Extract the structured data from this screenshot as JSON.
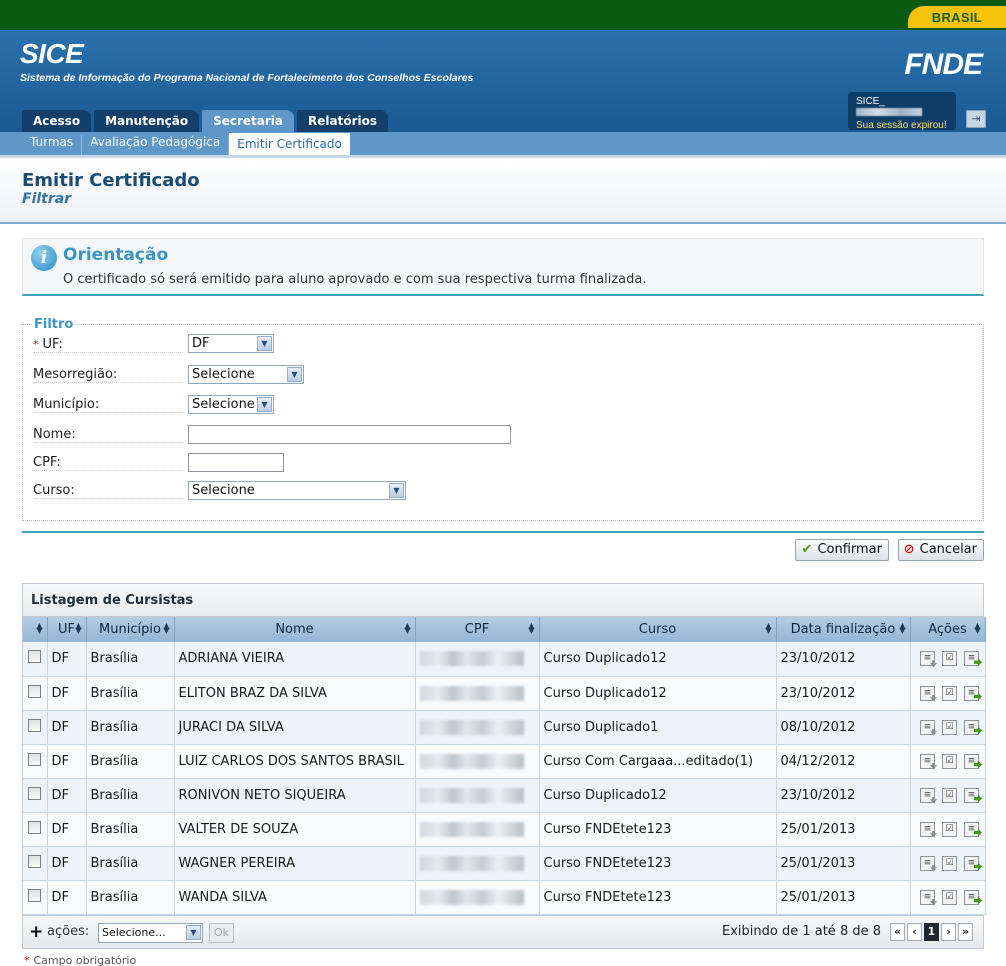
{
  "gov": {
    "brasil_label": "BRASIL"
  },
  "header": {
    "title": "SICE",
    "subtitle": "Sistema de Informação do Programa Nacional de Fortalecimento dos Conselhos Escolares",
    "org_logo": "FNDE",
    "user_prefix": "SICE_",
    "session_text": "Sua sessão expirou!"
  },
  "tabs": [
    {
      "label": "Acesso"
    },
    {
      "label": "Manutenção"
    },
    {
      "label": "Secretaria"
    },
    {
      "label": "Relatórios"
    }
  ],
  "subnav": [
    {
      "label": "Turmas"
    },
    {
      "label": "Avaliação Pedagógica"
    },
    {
      "label": "Emitir Certificado"
    }
  ],
  "page": {
    "title": "Emitir Certificado",
    "subtitle": "Filtrar"
  },
  "orientation": {
    "title": "Orientação",
    "text": "O certificado só será emitido para aluno aprovado e com sua respectiva turma finalizada."
  },
  "filter": {
    "legend": "Filtro",
    "uf_label": "UF:",
    "uf_value": "DF",
    "meso_label": "Mesorregião:",
    "meso_value": "Selecione",
    "mun_label": "Município:",
    "mun_value": "Selecione",
    "nome_label": "Nome:",
    "cpf_label": "CPF:",
    "curso_label": "Curso:",
    "curso_value": "Selecione"
  },
  "buttons": {
    "confirm": "Confirmar",
    "cancel": "Cancelar"
  },
  "listing": {
    "title": "Listagem de Cursistas",
    "columns": [
      "UF",
      "Município",
      "Nome",
      "CPF",
      "Curso",
      "Data finalização",
      "Ações"
    ],
    "rows": [
      {
        "uf": "DF",
        "municipio": "Brasília",
        "nome": "ADRIANA VIEIRA",
        "curso": "Curso Duplicado12",
        "data": "23/10/2012"
      },
      {
        "uf": "DF",
        "municipio": "Brasília",
        "nome": "ELITON BRAZ DA SILVA",
        "curso": "Curso Duplicado12",
        "data": "23/10/2012"
      },
      {
        "uf": "DF",
        "municipio": "Brasília",
        "nome": "JURACI DA SILVA",
        "curso": "Curso Duplicado1",
        "data": "08/10/2012"
      },
      {
        "uf": "DF",
        "municipio": "Brasília",
        "nome": "LUIZ CARLOS DOS SANTOS BRASIL",
        "curso": "Curso Com Cargaaa...editado(1)",
        "data": "04/12/2012"
      },
      {
        "uf": "DF",
        "municipio": "Brasília",
        "nome": "RONIVON NETO SIQUEIRA",
        "curso": "Curso Duplicado12",
        "data": "23/10/2012"
      },
      {
        "uf": "DF",
        "municipio": "Brasília",
        "nome": "VALTER DE SOUZA",
        "curso": "Curso FNDEtete123",
        "data": "25/01/2013"
      },
      {
        "uf": "DF",
        "municipio": "Brasília",
        "nome": "WAGNER PEREIRA",
        "curso": "Curso FNDEtete123",
        "data": "25/01/2013"
      },
      {
        "uf": "DF",
        "municipio": "Brasília",
        "nome": "WANDA SILVA",
        "curso": "Curso FNDEtete123",
        "data": "25/01/2013"
      }
    ],
    "bulk_label": "ações:",
    "bulk_select": "Selecione...",
    "ok_label": "Ok",
    "pager_text": "Exibindo de 1 até 8 de 8",
    "current_page": "1",
    "pager_first": "«",
    "pager_prev": "‹",
    "pager_next": "›",
    "pager_last": "»"
  },
  "required_note": "Campo obrigatório",
  "colors": {
    "accent": "#3f9fbf",
    "header": "#1b5a94",
    "gov_green": "#0b5a14",
    "brasil_yellow": "#f6c30b"
  },
  "icons": [
    "info-icon",
    "check-icon",
    "cancel-icon",
    "logout-icon",
    "plus-icon",
    "certificate-icon",
    "clipboard-icon",
    "send-icon",
    "sort-icon",
    "select-arrow-icon"
  ]
}
